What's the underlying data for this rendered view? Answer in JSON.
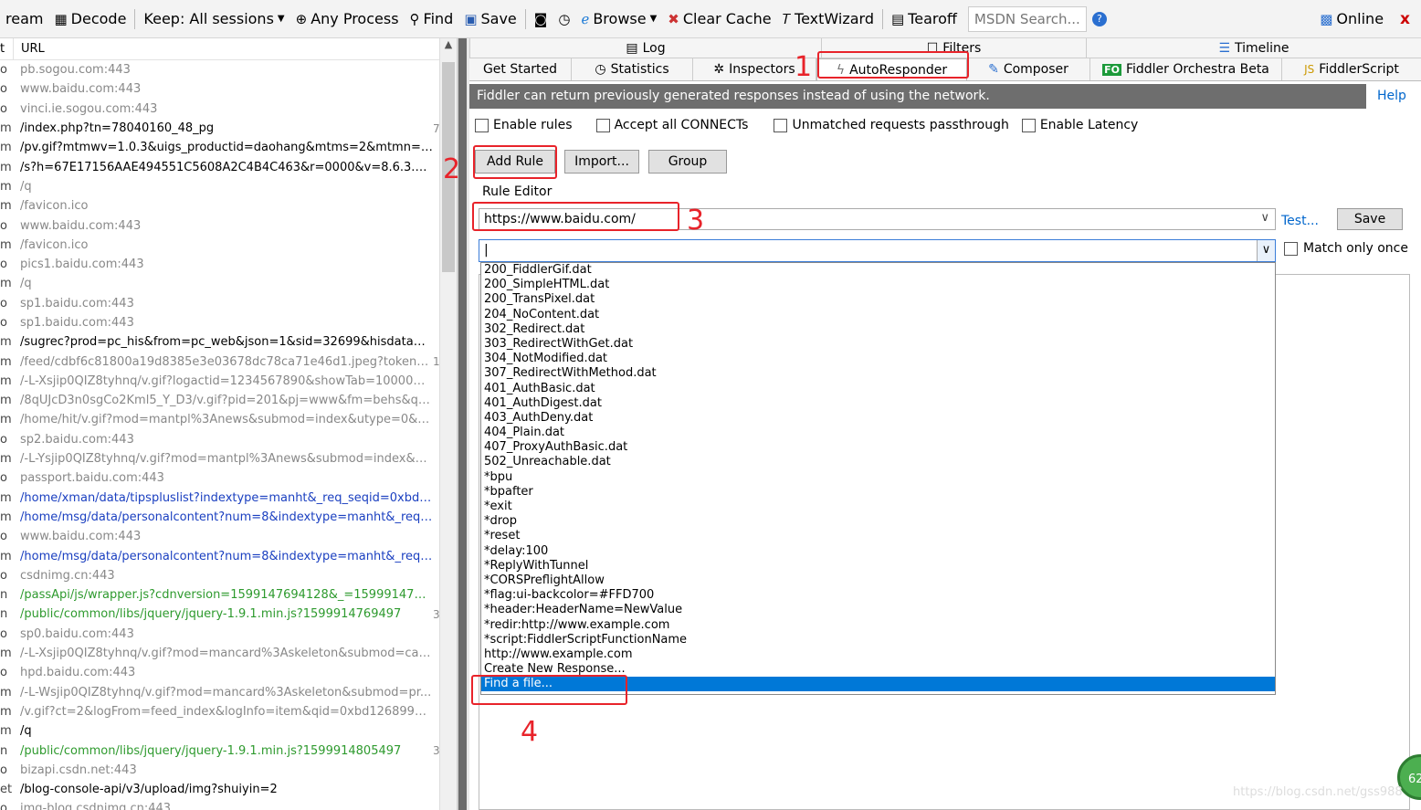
{
  "toolbar": {
    "stream": "ream",
    "decode": "Decode",
    "keep": "Keep: All sessions",
    "process": "Any Process",
    "find": "Find",
    "save": "Save",
    "browse": "Browse",
    "clear_cache": "Clear Cache",
    "textwizard": "TextWizard",
    "tearoff": "Tearoff",
    "msdn": "MSDN Search...",
    "online": "Online",
    "close": "x"
  },
  "sessions": {
    "col_result": "t",
    "col_url": "URL",
    "rows": [
      {
        "res": "o",
        "url": "pb.sogou.com:443",
        "color": "#888888",
        "body": ""
      },
      {
        "res": "o",
        "url": "www.baidu.com:443",
        "color": "#888888",
        "body": ""
      },
      {
        "res": "o",
        "url": "vinci.ie.sogou.com:443",
        "color": "#888888",
        "body": ""
      },
      {
        "res": "m",
        "url": "/index.php?tn=78040160_48_pg",
        "color": "#000000",
        "body": "7"
      },
      {
        "res": "m",
        "url": "/pv.gif?mtmwv=1.0.3&uigs_productid=daohang&mtms=2&mtmn=14...",
        "color": "#000000",
        "body": ""
      },
      {
        "res": "m",
        "url": "/s?h=67E17156AAE494551C5608A2C4B4C463&r=0000&v=8.6.3.32...",
        "color": "#000000",
        "body": ""
      },
      {
        "res": "m",
        "url": "/q",
        "color": "#888888",
        "body": ""
      },
      {
        "res": "m",
        "url": "/favicon.ico",
        "color": "#888888",
        "body": ""
      },
      {
        "res": "o",
        "url": "www.baidu.com:443",
        "color": "#888888",
        "body": ""
      },
      {
        "res": "m",
        "url": "/favicon.ico",
        "color": "#888888",
        "body": ""
      },
      {
        "res": "o",
        "url": "pics1.baidu.com:443",
        "color": "#888888",
        "body": ""
      },
      {
        "res": "m",
        "url": "/q",
        "color": "#888888",
        "body": ""
      },
      {
        "res": "o",
        "url": "sp1.baidu.com:443",
        "color": "#888888",
        "body": ""
      },
      {
        "res": "o",
        "url": "sp1.baidu.com:443",
        "color": "#888888",
        "body": ""
      },
      {
        "res": "m",
        "url": "/sugrec?prod=pc_his&from=pc_web&json=1&sid=32699&hisdata=...",
        "color": "#000000",
        "body": ""
      },
      {
        "res": "m",
        "url": "/feed/cdbf6c81800a19d8385e3e03678dc78ca71e46d1.jpeg?token=...",
        "color": "#888888",
        "body": "1"
      },
      {
        "res": "m",
        "url": "/-L-Xsjip0QIZ8tyhnq/v.gif?logactid=1234567890&showTab=10000&...",
        "color": "#888888",
        "body": ""
      },
      {
        "res": "m",
        "url": "/8qUJcD3n0sgCo2Kml5_Y_D3/v.gif?pid=201&pj=www&fm=behs&qid...",
        "color": "#888888",
        "body": ""
      },
      {
        "res": "m",
        "url": "/home/hit/v.gif?mod=mantpl%3Anews&submod=index&utype=0&su...",
        "color": "#888888",
        "body": ""
      },
      {
        "res": "o",
        "url": "sp2.baidu.com:443",
        "color": "#888888",
        "body": ""
      },
      {
        "res": "m",
        "url": "/-L-Ysjip0QIZ8tyhnq/v.gif?mod=mantpl%3Anews&submod=index&ut...",
        "color": "#888888",
        "body": ""
      },
      {
        "res": "o",
        "url": "passport.baidu.com:443",
        "color": "#888888",
        "body": ""
      },
      {
        "res": "m",
        "url": "/home/xman/data/tipspluslist?indextype=manht&_req_seqid=0xbd1...",
        "color": "#1a3fc0",
        "body": ""
      },
      {
        "res": "m",
        "url": "/home/msg/data/personalcontent?num=8&indextype=manht&_req_...",
        "color": "#1a3fc0",
        "body": ""
      },
      {
        "res": "o",
        "url": "www.baidu.com:443",
        "color": "#888888",
        "body": ""
      },
      {
        "res": "m",
        "url": "/home/msg/data/personalcontent?num=8&indextype=manht&_req_...",
        "color": "#1a3fc0",
        "body": ""
      },
      {
        "res": "o",
        "url": "csdnimg.cn:443",
        "color": "#888888",
        "body": ""
      },
      {
        "res": "n",
        "url": "/passApi/js/wrapper.js?cdnversion=1599147694128&_=159991476...",
        "color": "#2e9a2e",
        "body": ""
      },
      {
        "res": "n",
        "url": "/public/common/libs/jquery/jquery-1.9.1.min.js?1599914769497",
        "color": "#2e9a2e",
        "body": "3"
      },
      {
        "res": "o",
        "url": "sp0.baidu.com:443",
        "color": "#888888",
        "body": ""
      },
      {
        "res": "m",
        "url": "/-L-Xsjip0QIZ8tyhnq/v.gif?mod=mancard%3Askeleton&submod=car...",
        "color": "#888888",
        "body": ""
      },
      {
        "res": "o",
        "url": "hpd.baidu.com:443",
        "color": "#888888",
        "body": ""
      },
      {
        "res": "m",
        "url": "/-L-Wsjip0QIZ8tyhnq/v.gif?mod=mancard%3Askeleton&submod=pr...",
        "color": "#888888",
        "body": ""
      },
      {
        "res": "m",
        "url": "/v.gif?ct=2&logFrom=feed_index&logInfo=item&qid=0xbd12689900...",
        "color": "#888888",
        "body": ""
      },
      {
        "res": "m",
        "url": "/q",
        "color": "#000000",
        "body": ""
      },
      {
        "res": "n",
        "url": "/public/common/libs/jquery/jquery-1.9.1.min.js?1599914805497",
        "color": "#2e9a2e",
        "body": "3"
      },
      {
        "res": "o",
        "url": "bizapi.csdn.net:443",
        "color": "#888888",
        "body": ""
      },
      {
        "res": "et",
        "url": "/blog-console-api/v3/upload/img?shuiyin=2",
        "color": "#000000",
        "body": ""
      },
      {
        "res": "o",
        "url": "img-blog.csdnimg.cn:443",
        "color": "#888888",
        "body": ""
      }
    ]
  },
  "tabs_row1": {
    "log": "Log",
    "filters": "Filters",
    "timeline": "Timeline"
  },
  "tabs_row2": {
    "get_started": "Get Started",
    "statistics": "Statistics",
    "inspectors": "Inspectors",
    "autoresponder": "AutoResponder",
    "composer": "Composer",
    "orchestra": "Fiddler Orchestra Beta",
    "fiddlerscript": "FiddlerScript"
  },
  "autoresponder": {
    "banner": "Fiddler can return previously generated responses instead of using the network.",
    "help": "Help",
    "enable_rules": "Enable rules",
    "accept_connects": "Accept all CONNECTs",
    "unmatched": "Unmatched requests passthrough",
    "enable_latency": "Enable Latency",
    "add_rule": "Add Rule",
    "import": "Import...",
    "group": "Group",
    "rule_editor": "Rule Editor",
    "match_value": "https://www.baidu.com/",
    "test": "Test...",
    "save": "Save",
    "action_value": "|",
    "match_only_once": "Match only once",
    "options": [
      "200_FiddlerGif.dat",
      "200_SimpleHTML.dat",
      "200_TransPixel.dat",
      "204_NoContent.dat",
      "302_Redirect.dat",
      "303_RedirectWithGet.dat",
      "304_NotModified.dat",
      "307_RedirectWithMethod.dat",
      "401_AuthBasic.dat",
      "401_AuthDigest.dat",
      "403_AuthDeny.dat",
      "404_Plain.dat",
      "407_ProxyAuthBasic.dat",
      "502_Unreachable.dat",
      "*bpu",
      "*bpafter",
      "*exit",
      "*drop",
      "*reset",
      "*delay:100",
      "*ReplyWithTunnel",
      "*CORSPreflightAllow",
      "*flag:ui-backcolor=#FFD700",
      "*header:HeaderName=NewValue",
      "*redir:http://www.example.com",
      "*script:FiddlerScriptFunctionName",
      "http://www.example.com",
      "Create New Response...",
      "Find a file..."
    ],
    "highlighted_index": 28
  },
  "annotations": {
    "n1": "1",
    "n2": "2",
    "n3": "3",
    "n4": "4"
  },
  "badge": "62",
  "watermark": "https://blog.csdn.net/gss988"
}
